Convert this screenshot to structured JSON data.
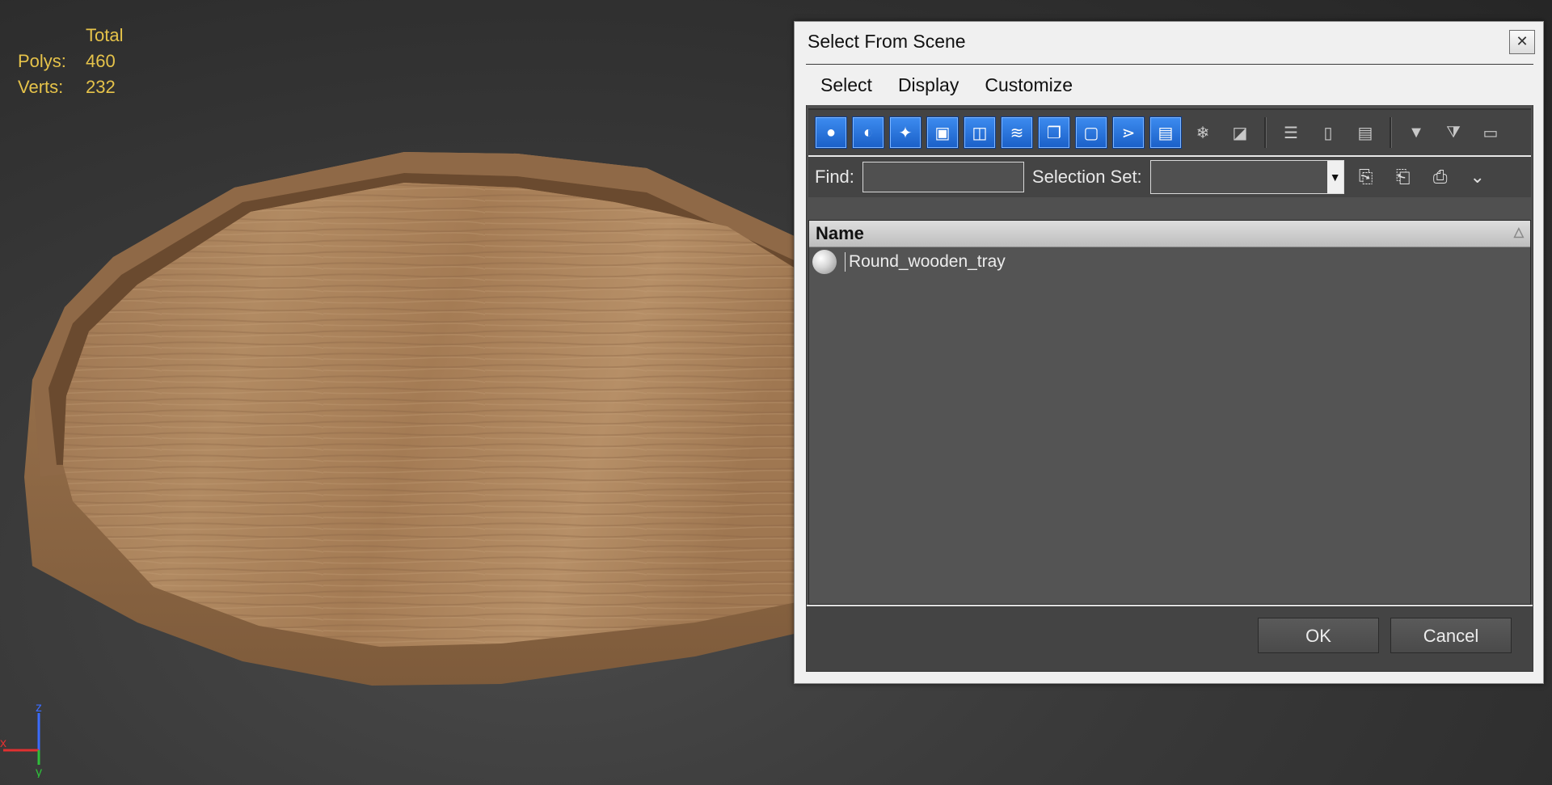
{
  "viewport": {
    "stats": {
      "header": "Total",
      "polys_label": "Polys:",
      "polys_value": "460",
      "verts_label": "Verts:",
      "verts_value": "232"
    },
    "axes": {
      "z": "z",
      "x": "x",
      "y": "y"
    }
  },
  "dialog": {
    "title": "Select From Scene",
    "close_icon": "close-icon",
    "menu": [
      "Select",
      "Display",
      "Customize"
    ],
    "toolbar": [
      {
        "icon": "geometry-icon",
        "active": true
      },
      {
        "icon": "shapes-icon",
        "active": true
      },
      {
        "icon": "lights-icon",
        "active": true
      },
      {
        "icon": "cameras-icon",
        "active": true
      },
      {
        "icon": "helpers-icon",
        "active": true
      },
      {
        "icon": "space-warps-icon",
        "active": true
      },
      {
        "icon": "groups-icon",
        "active": true
      },
      {
        "icon": "xrefs-icon",
        "active": true
      },
      {
        "icon": "bones-icon",
        "active": true
      },
      {
        "icon": "containers-icon",
        "active": true
      },
      {
        "icon": "frozen-icon",
        "active": false
      },
      {
        "icon": "hidden-icon",
        "active": false
      },
      {
        "icon": "select-all-icon",
        "active": false
      },
      {
        "icon": "select-none-icon",
        "active": false
      },
      {
        "icon": "invert-selection-icon",
        "active": false
      },
      {
        "icon": "filter-icon",
        "active": false
      },
      {
        "icon": "filter-options-icon",
        "active": false
      },
      {
        "icon": "display-children-icon",
        "active": false
      }
    ],
    "find_label": "Find:",
    "find_value": "",
    "selection_set_label": "Selection Set:",
    "selection_set_value": "",
    "column_name": "Name",
    "objects": [
      {
        "name": "Round_wooden_tray",
        "icon": "sphere-object-icon"
      }
    ],
    "ok_label": "OK",
    "cancel_label": "Cancel"
  }
}
